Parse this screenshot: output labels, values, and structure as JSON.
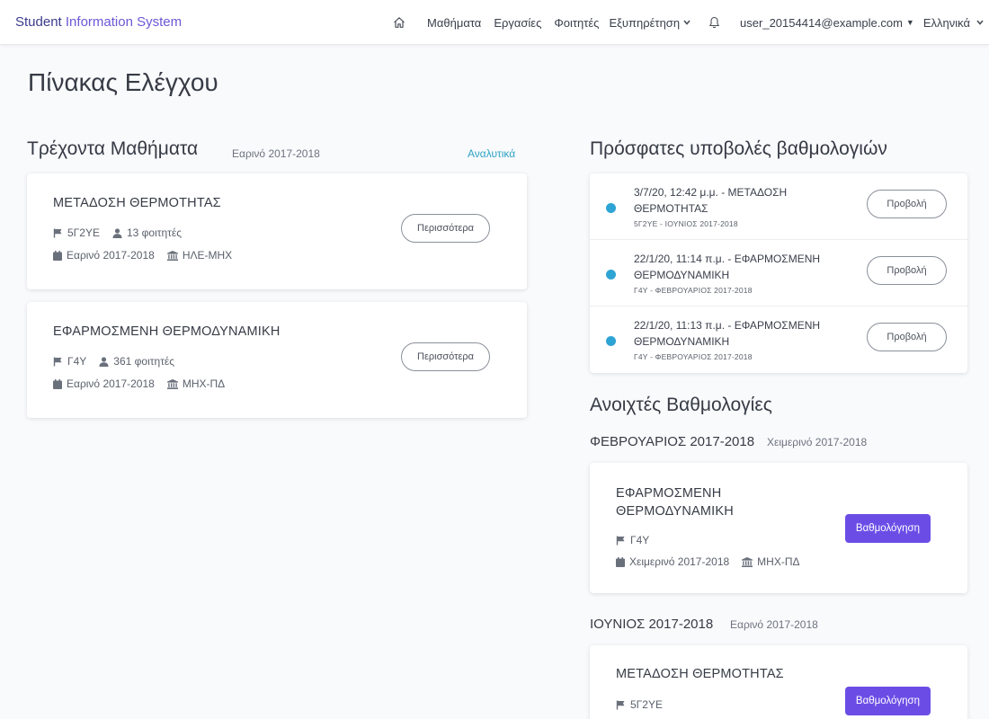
{
  "navbar": {
    "brand_part1": "Student",
    "brand_part2": "Information System",
    "home_icon": "home-icon",
    "courses": "Μαθήματα",
    "assignments": "Εργασίες",
    "students": "Φοιτητές",
    "support": "Εξυπηρέτηση",
    "bell_icon": "bell-icon",
    "user": "user_20154414@example.com",
    "language": "Ελληνικά"
  },
  "page_title": "Πίνακας Ελέγχου",
  "current_courses": {
    "title": "Τρέχοντα Μαθήματα",
    "semester": "Εαρινό 2017-2018",
    "details_link": "Αναλυτικά",
    "items": [
      {
        "name": "ΜΕΤΑΔΟΣΗ ΘΕΡΜΟΤΗΤΑΣ",
        "code": "5Γ2ΥΕ",
        "students": "13 φοιτητές",
        "semester": "Εαρινό 2017-2018",
        "department": "ΗΛΕ-ΜΗΧ",
        "button": "Περισσότερα"
      },
      {
        "name": "ΕΦΑΡΜΟΣΜΕΝΗ ΘΕΡΜΟΔΥΝΑΜΙΚΗ",
        "code": "Γ4Υ",
        "students": "361 φοιτητές",
        "semester": "Εαρινό 2017-2018",
        "department": "ΜΗΧ-ΠΔ",
        "button": "Περισσότερα"
      }
    ]
  },
  "recent_submissions": {
    "title": "Πρόσφατες υποβολές βαθμολογιών",
    "items": [
      {
        "line1": "3/7/20, 12:42 μ.μ. - ΜΕΤΑΔΟΣΗ",
        "line2": "ΘΕΡΜΟΤΗΤΑΣ",
        "small": "5Γ2ΥΕ - ΙΟΥΝΙΟΣ 2017-2018",
        "button": "Προβολή"
      },
      {
        "line1": "22/1/20, 11:14 π.μ. - ΕΦΑΡΜΟΣΜΕΝΗ",
        "line2": "ΘΕΡΜΟΔΥΝΑΜΙΚΗ",
        "small": "Γ4Υ - ΦΕΒΡΟΥΑΡΙΟΣ 2017-2018",
        "button": "Προβολή"
      },
      {
        "line1": "22/1/20, 11:13 π.μ. - ΕΦΑΡΜΟΣΜΕΝΗ",
        "line2": "ΘΕΡΜΟΔΥΝΑΜΙΚΗ",
        "small": "Γ4Υ - ΦΕΒΡΟΥΑΡΙΟΣ 2017-2018",
        "button": "Προβολή"
      }
    ]
  },
  "open_grades": {
    "title": "Ανοιχτές Βαθμολογίες",
    "periods": [
      {
        "title": "ΦΕΒΡΟΥΑΡΙΟΣ 2017-2018",
        "semester": "Χειμερινό 2017-2018",
        "course": {
          "name_line1": "ΕΦΑΡΜΟΣΜΕΝΗ",
          "name_line2": "ΘΕΡΜΟΔΥΝΑΜΙΚΗ",
          "code": "Γ4Υ",
          "semester": "Χειμερινό 2017-2018",
          "department": "ΜΗΧ-ΠΔ",
          "button": "Βαθμολόγηση"
        }
      },
      {
        "title": "ΙΟΥΝΙΟΣ 2017-2018",
        "semester": "Εαρινό 2017-2018",
        "course": {
          "name_line1": "ΜΕΤΑΔΟΣΗ ΘΕΡΜΟΤΗΤΑΣ",
          "code": "5Γ2ΥΕ",
          "button": "Βαθμολόγηση"
        }
      }
    ]
  },
  "colors": {
    "primary": "#6b4de6",
    "link": "#2ea4c4",
    "status_dot": "#2ea4d4"
  }
}
